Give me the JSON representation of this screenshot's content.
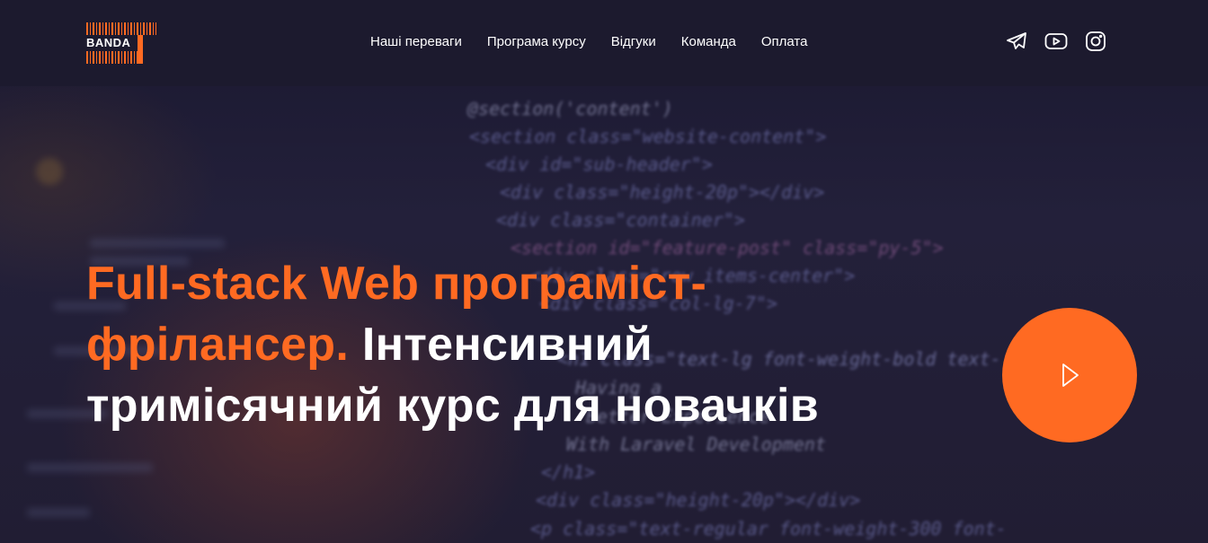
{
  "brand": {
    "logo_text": "BANDA",
    "accent_color": "#ff6a22"
  },
  "nav": {
    "items": [
      {
        "label": "Наші переваги"
      },
      {
        "label": "Програма курсу"
      },
      {
        "label": "Відгуки"
      },
      {
        "label": "Команда"
      },
      {
        "label": "Оплата"
      }
    ]
  },
  "social": {
    "icons": [
      "telegram-icon",
      "youtube-icon",
      "instagram-icon"
    ]
  },
  "hero": {
    "title_accent": "Full-stack Web програміст-фрілансер.",
    "title_rest": " Інтенсивний тримісячний курс для новачків",
    "play_icon": "play-icon"
  },
  "code_bg": {
    "lines": [
      "@section('content')",
      "<section class=\"website-content\">",
      "<div id=\"sub-header\">",
      "<div class=\"height-20p\"></div>",
      "<div class=\"container\">",
      "<section id=\"feature-post\" class=\"py-5\">",
      "<div class=\"row items-center\">",
      "<div class=\"col-lg-7\">",
      "<h1 class=\"text-lg font-weight-bold text-",
      "Having a",
      "Better Experience",
      "With Laravel Development",
      "</h1>",
      "<div class=\"height-20p\"></div>",
      "<p class=\"text-regular font-weight-300 font-"
    ]
  }
}
